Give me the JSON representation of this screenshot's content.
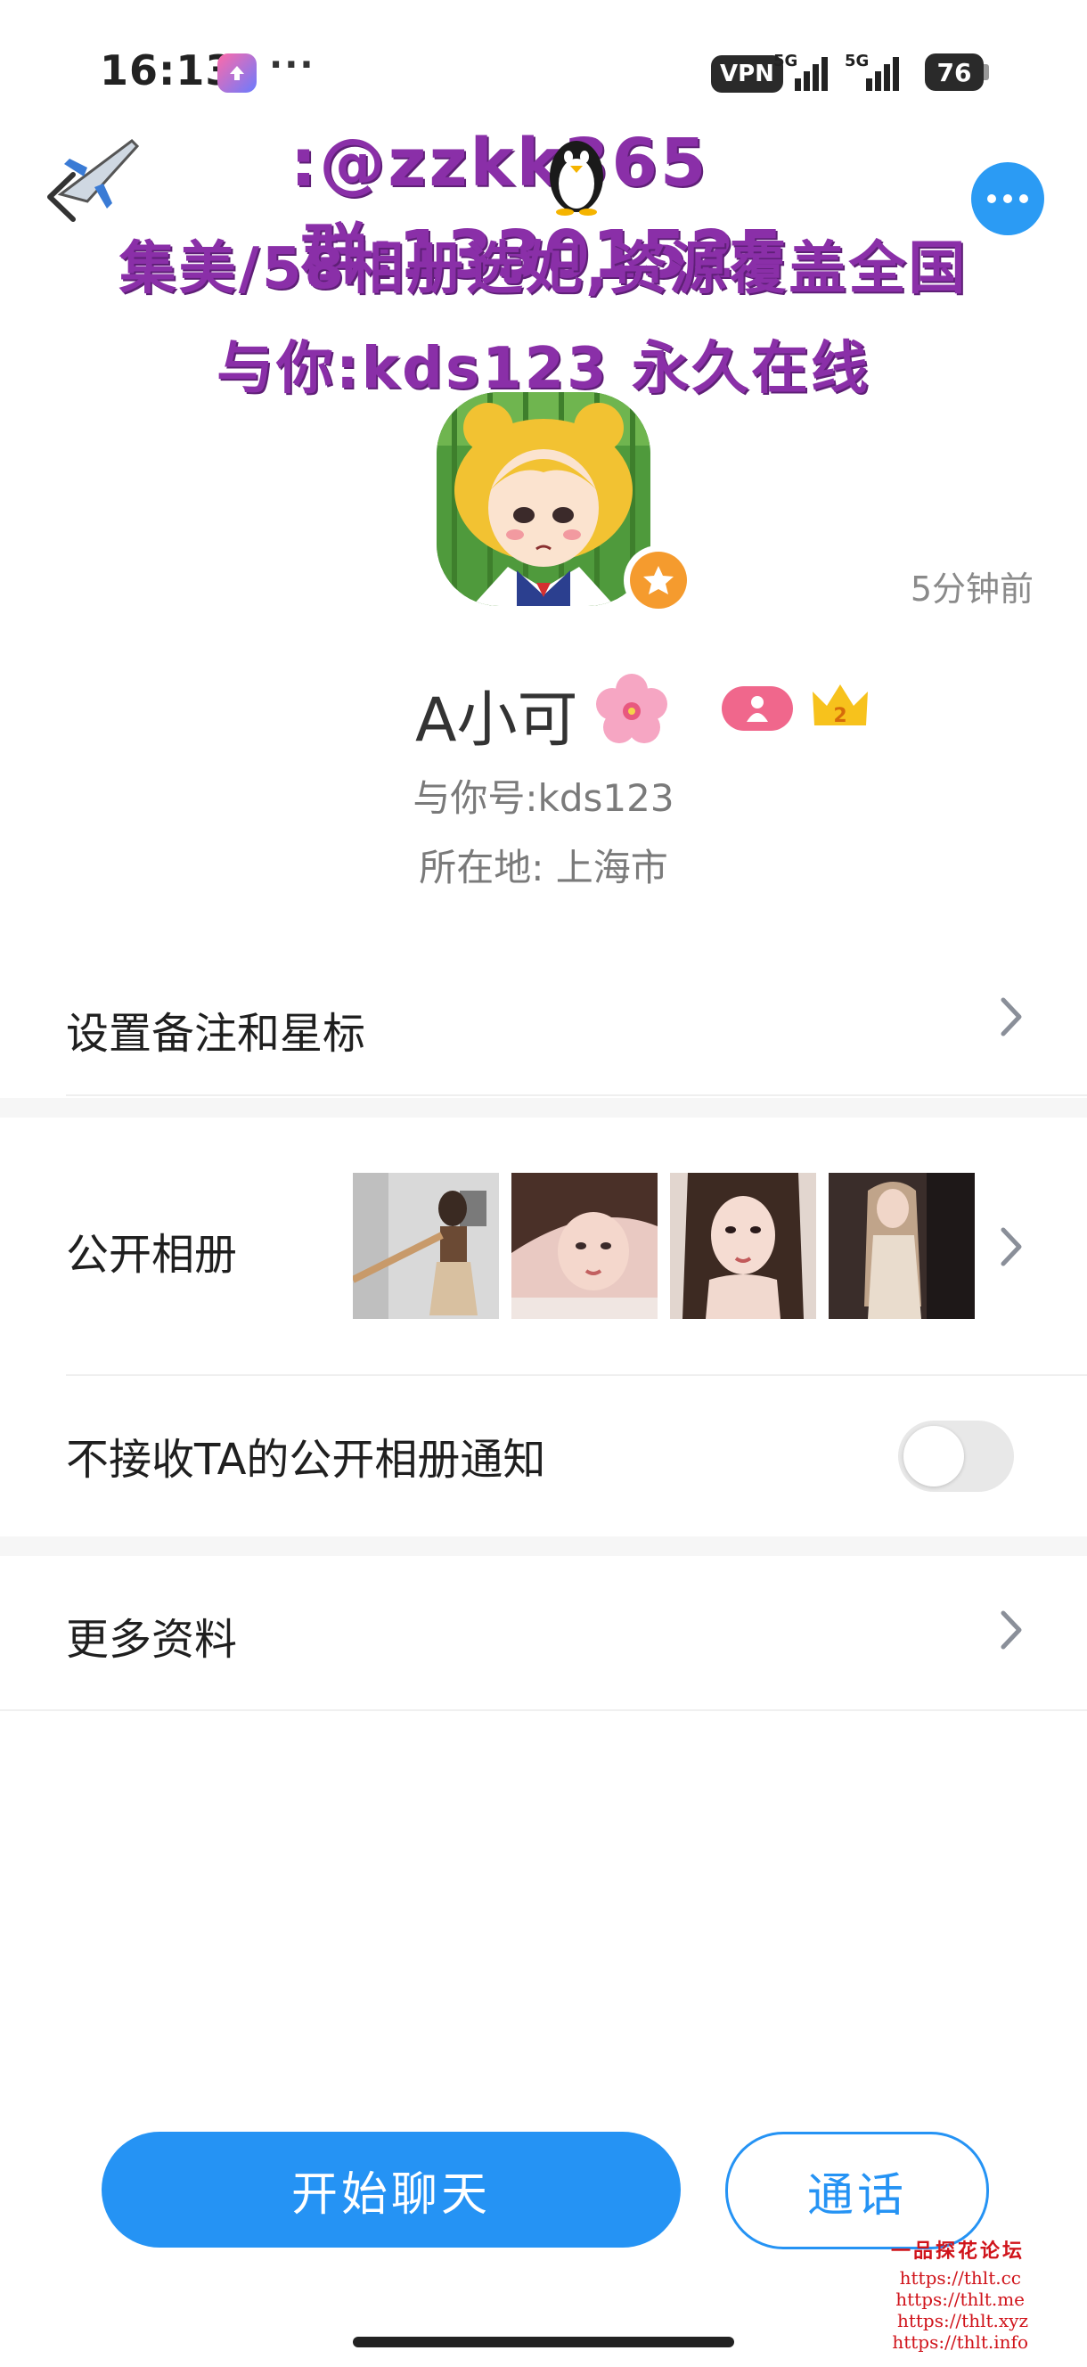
{
  "status_bar": {
    "time": "16:13",
    "dots": "···",
    "vpn": "VPN",
    "signal_1": "5G",
    "signal_2": "5G",
    "battery": "76"
  },
  "banner": {
    "line1_contact": ":@zzkk365",
    "line1_group": "群:13301525",
    "line2": "集美/58相册选妃,资源覆盖全国",
    "line3": "与你:kds123 永久在线"
  },
  "profile": {
    "last_seen": "5分钟前",
    "name": "A小可",
    "crown_level": "2",
    "id_line": "与你号:kds123",
    "location_line": "所在地: 上海市"
  },
  "rows": {
    "remark": "设置备注和星标",
    "album": "公开相册",
    "album_notify": "不接收TA的公开相册通知",
    "album_notify_on": false,
    "more_info": "更多资料"
  },
  "actions": {
    "chat": "开始聊天",
    "call": "通话"
  },
  "watermark": {
    "title": "一品探花论坛",
    "links": [
      "https://thlt.cc",
      "https://thlt.me",
      "https://thlt.xyz",
      "https://thlt.info"
    ]
  },
  "colors": {
    "accent": "#2593f4",
    "banner_text": "#8a2fa8",
    "badge_orange": "#f59b2e",
    "gender_pink": "#f0678c"
  }
}
